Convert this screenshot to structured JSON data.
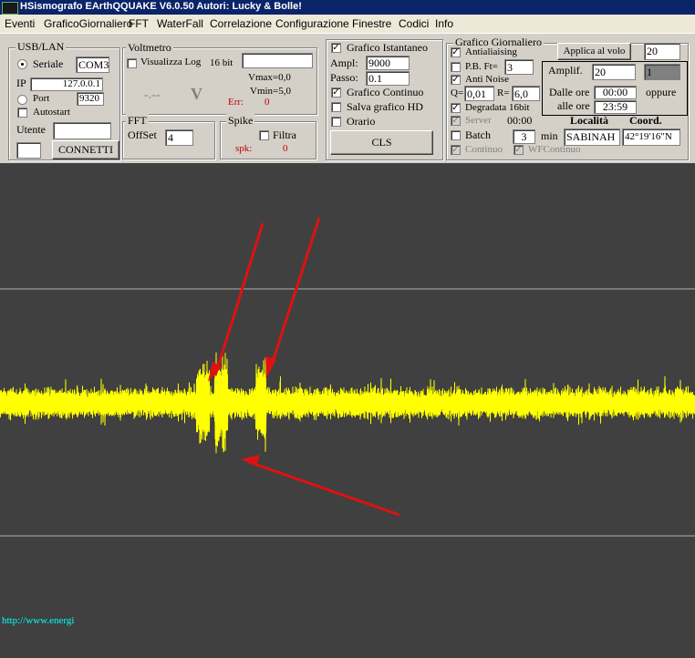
{
  "window": {
    "title": "HSismografo EArthQQUAKE  V6.0.50  Autori: Lucky & Bolle!"
  },
  "menu": [
    "Eventi",
    "GraficoGiornaliero",
    "FFT",
    "WaterFall",
    "Correlazione",
    "Configurazione",
    "Finestre",
    "Codici",
    "Info"
  ],
  "usb": {
    "legend": "USB/LAN",
    "seriale_label": "Seriale",
    "com_value": "COM3",
    "ip_label": "IP",
    "ip_value": "127.0.0.1",
    "port_label": "Port",
    "port_value": "9320",
    "autostart_label": "Autostart",
    "utente_label": "Utente",
    "utente_value": "",
    "connect_label": "CONNETTI"
  },
  "voltmetro": {
    "legend": "Voltmetro",
    "log_label": "Visualizza Log",
    "bits": "16 bit",
    "display": "-.--",
    "unit": "V",
    "vmax": "Vmax=0,0",
    "vmin": "Vmin=5,0",
    "err_label": "Err:",
    "err_value": "0"
  },
  "fft": {
    "legend": "FFT",
    "offset_label": "OffSet",
    "offset_value": "4"
  },
  "spike": {
    "legend": "Spike",
    "filtra_label": "Filtra",
    "spk_label": "spk:",
    "spk_value": "0"
  },
  "istantaneo": {
    "title": "Grafico Istantaneo",
    "ampl_label": "Ampl:",
    "ampl_value": "9000",
    "passo_label": "Passo:",
    "passo_value": "0.1",
    "continuo_label": "Grafico Continuo",
    "salva_label": "Salva grafico HD",
    "orario_label": "Orario",
    "cls_label": "CLS"
  },
  "giornaliero": {
    "legend": "Grafico Giornaliero",
    "antialiasing_label": "Antialiaising",
    "pb_label": "P.B. Ft=",
    "pb_value": "3",
    "antinoise_label": "Anti Noise",
    "q_label": "Q=",
    "q_value": "0,01",
    "r_label": "R=",
    "r_value": "6,0",
    "degradata_label": "Degradata 16bit",
    "server_label": "Server",
    "server_time": "00:00",
    "batch_label": "Batch",
    "batch_value": "3",
    "min_label": "min",
    "continuo_label": "Continuo",
    "wfcontinuo_label": "WFContinuo",
    "applica_label": "Applica al volo",
    "applica_value": "20",
    "amplif_label": "Amplif.",
    "amplif_value": "20",
    "amplif_alt": "1",
    "dalle_label": "Dalle ore",
    "dalle_value": "00:00",
    "oppure_label": "oppure",
    "alle_label": "alle ore",
    "alle_value": "23:59",
    "localita_label": "Località",
    "localita_value": "SABINAH",
    "coord_label": "Coord.",
    "coord_value": "42°19'16\"N"
  },
  "plot": {
    "url": "http://www.energi",
    "trace_color": "#ffff00",
    "grid_color": "#b0b0b0",
    "arrow_color": "#e01010",
    "background": "#404040"
  }
}
